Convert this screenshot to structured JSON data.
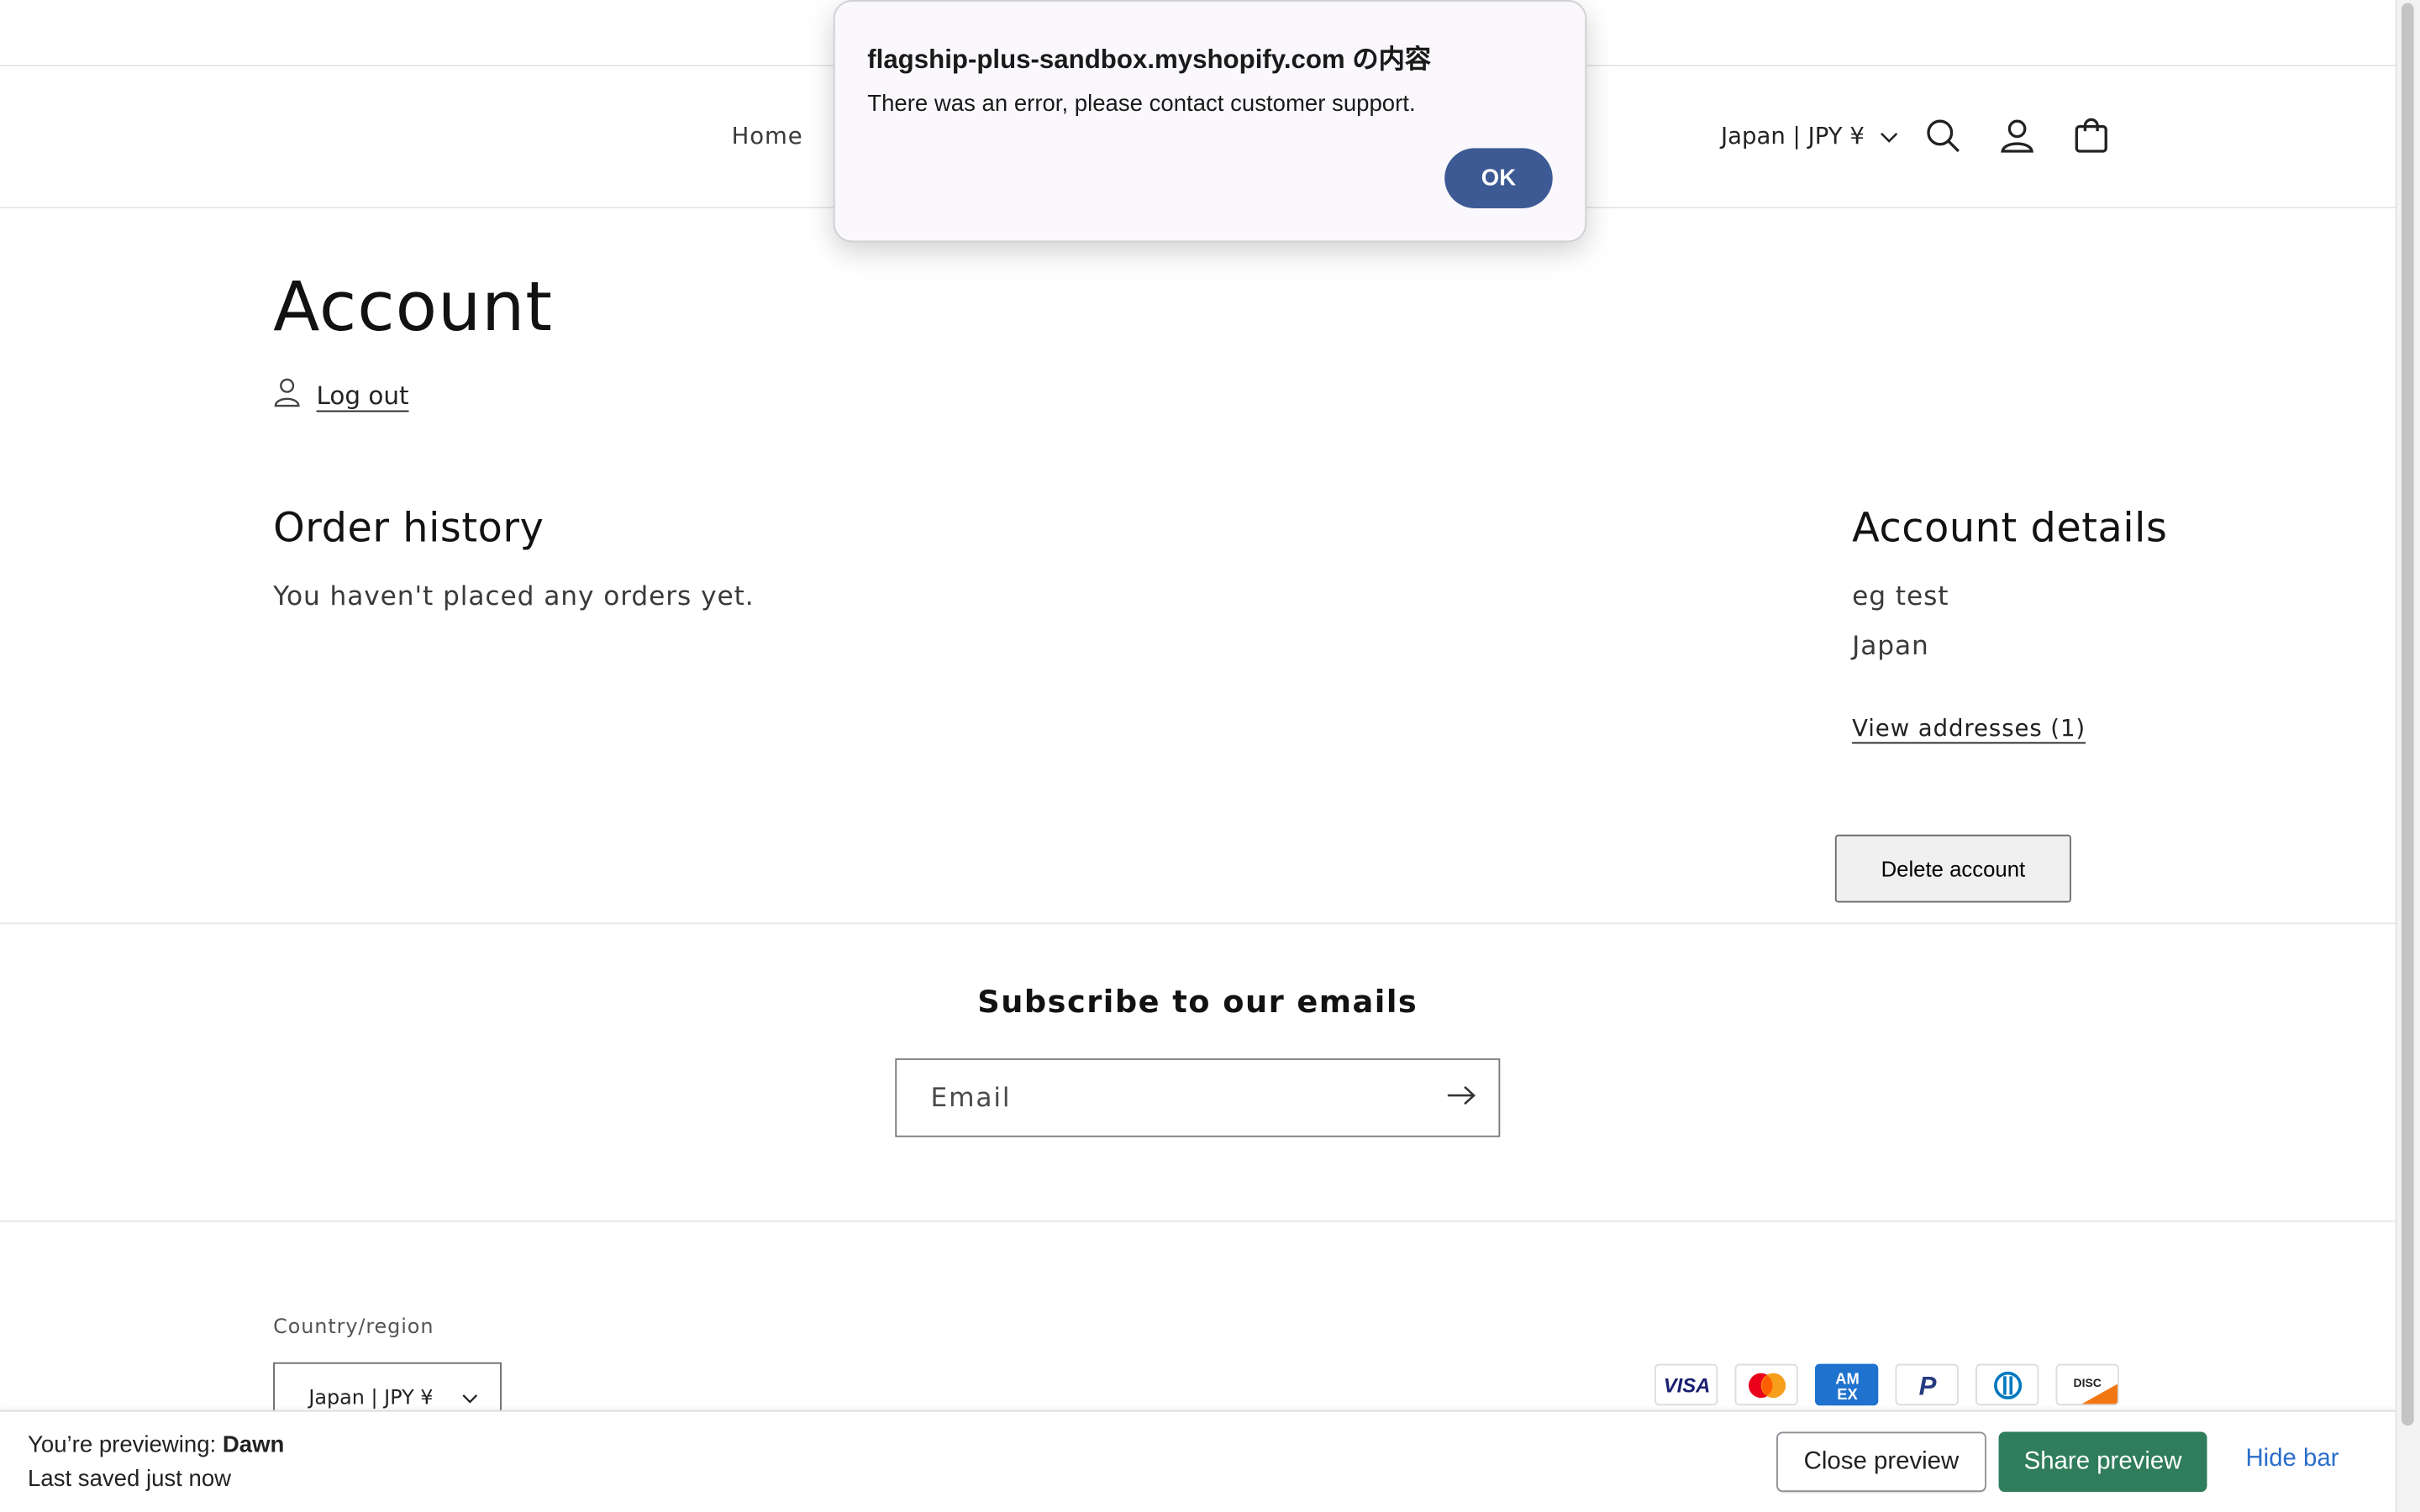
{
  "header": {
    "nav_home": "Home",
    "currency": "Japan | JPY ¥"
  },
  "account": {
    "title": "Account",
    "logout": "Log out",
    "order_history": {
      "heading": "Order history",
      "empty_text": "You haven't placed any orders yet."
    },
    "details": {
      "heading": "Account details",
      "name": "eg test",
      "country": "Japan",
      "view_addresses": "View addresses (1)"
    },
    "delete_button": "Delete account"
  },
  "subscribe": {
    "heading": "Subscribe to our emails",
    "email_placeholder": "Email"
  },
  "footer": {
    "country_label": "Country/region",
    "country_value": "Japan | JPY ¥",
    "payment_methods": [
      "Visa",
      "Mastercard",
      "American Express",
      "PayPal",
      "Diners Club",
      "Discover"
    ]
  },
  "preview_bar": {
    "previewing_prefix": "You’re previewing:",
    "theme_name": "Dawn",
    "saved_status": "Last saved just now",
    "close_label": "Close preview",
    "share_label": "Share preview",
    "hide_label": "Hide bar"
  },
  "dialog": {
    "title": "flagship-plus-sandbox.myshopify.com の内容",
    "message": "There was an error, please contact customer support.",
    "ok_label": "OK"
  },
  "colors": {
    "share_button": "#2f7d5b",
    "hide_link": "#2c6ecb",
    "dialog_ok": "#3d5a95"
  }
}
